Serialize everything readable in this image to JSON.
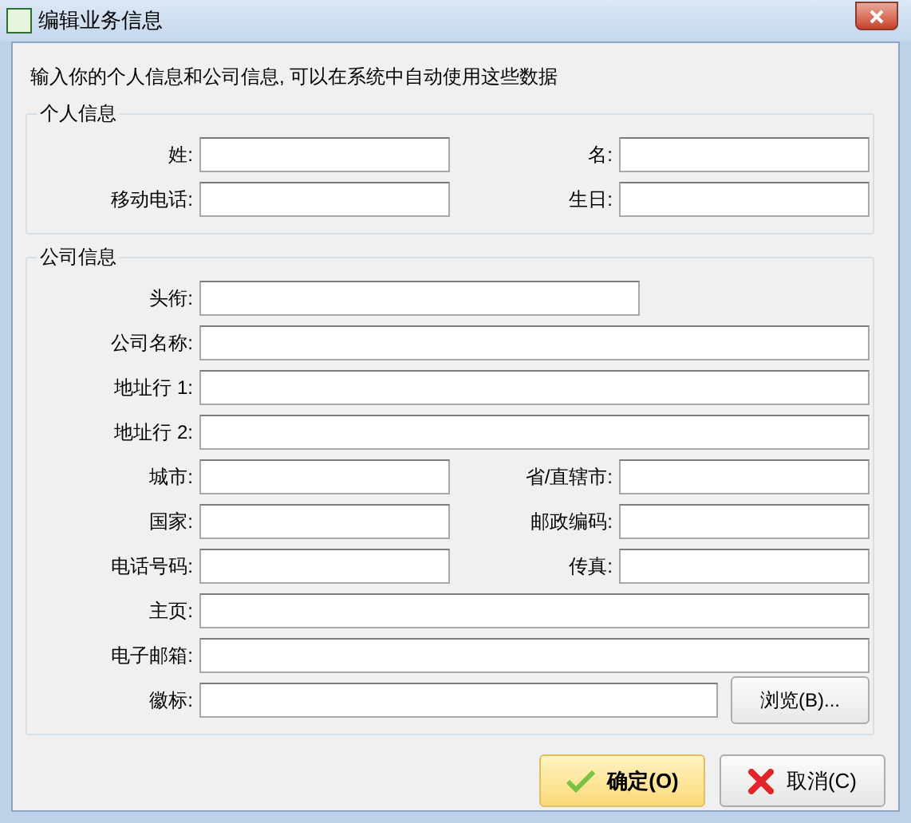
{
  "window": {
    "title": "编辑业务信息"
  },
  "intro": "输入你的个人信息和公司信息, 可以在系统中自动使用这些数据",
  "groups": [
    {
      "title": "个人信息",
      "rows": [
        {
          "kind": "pair",
          "fields": [
            {
              "label": "姓:"
            },
            {
              "label": "名:"
            }
          ]
        },
        {
          "kind": "pair",
          "fields": [
            {
              "label": "移动电话:"
            },
            {
              "label": "生日:"
            }
          ]
        }
      ]
    },
    {
      "title": "公司信息",
      "rows": [
        {
          "kind": "medium",
          "fields": [
            {
              "label": "头衔:"
            }
          ]
        },
        {
          "kind": "full",
          "fields": [
            {
              "label": "公司名称:"
            }
          ]
        },
        {
          "kind": "full",
          "fields": [
            {
              "label": "地址行 1:"
            }
          ]
        },
        {
          "kind": "full",
          "fields": [
            {
              "label": "地址行 2:"
            }
          ]
        },
        {
          "kind": "pair",
          "fields": [
            {
              "label": "城市:"
            },
            {
              "label": "省/直辖市:"
            }
          ]
        },
        {
          "kind": "pair",
          "fields": [
            {
              "label": "国家:"
            },
            {
              "label": "邮政编码:"
            }
          ]
        },
        {
          "kind": "pair",
          "fields": [
            {
              "label": "电话号码:"
            },
            {
              "label": "传真:"
            }
          ]
        },
        {
          "kind": "full",
          "fields": [
            {
              "label": "主页:"
            }
          ]
        },
        {
          "kind": "full",
          "fields": [
            {
              "label": "电子邮箱:"
            }
          ]
        },
        {
          "kind": "browse",
          "fields": [
            {
              "label": "徽标:"
            }
          ],
          "button": "浏览(B)..."
        }
      ]
    }
  ],
  "buttons": [
    {
      "label": "确定(O)",
      "kind": "ok"
    },
    {
      "label": "取消(C)",
      "kind": "cancel"
    }
  ]
}
